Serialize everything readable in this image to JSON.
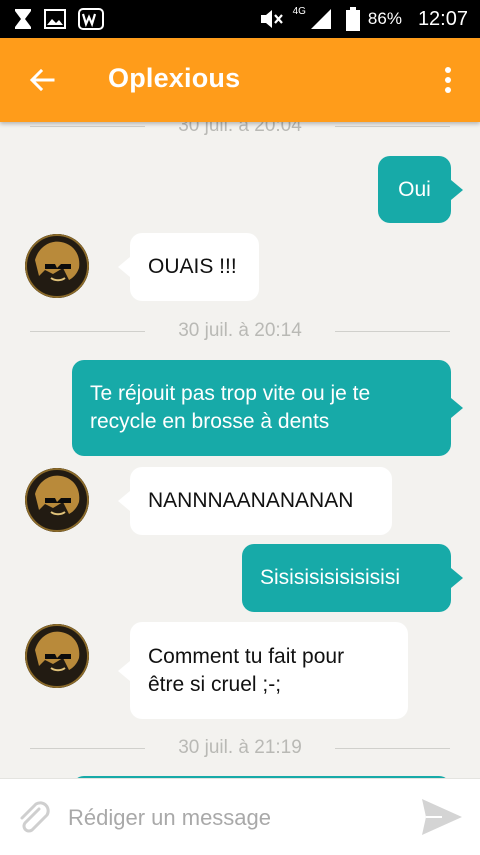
{
  "status_bar": {
    "network": "4G",
    "battery": "86%",
    "time": "12:07"
  },
  "header": {
    "title": "Oplexious",
    "back_icon": "arrow-back-icon",
    "menu_icon": "more-vert-icon"
  },
  "messages": [
    {
      "type": "divider",
      "text": "30 juil. à 20:04"
    },
    {
      "type": "out",
      "text": "Oui"
    },
    {
      "type": "in",
      "text": "OUAIS !!!"
    },
    {
      "type": "divider",
      "text": "30 juil. à 20:14"
    },
    {
      "type": "out",
      "lines": [
        "Te réjouit pas trop vite ou je te",
        "recycle en brosse à dents"
      ]
    },
    {
      "type": "in",
      "text": "NANNNAANANANAN"
    },
    {
      "type": "out",
      "text": "Sisisisisisisisisi"
    },
    {
      "type": "in",
      "lines": [
        "Comment tu fait pour",
        "être si cruel ;-;"
      ]
    },
    {
      "type": "divider",
      "text": "30 juil. à 21:19"
    }
  ],
  "compose": {
    "placeholder": "Rédiger un message",
    "attach_icon": "paperclip-icon",
    "send_icon": "send-icon"
  },
  "colors": {
    "app_bar": "#ff9c1a",
    "outgoing_bubble": "#17aaa8",
    "incoming_bubble": "#ffffff",
    "background": "#f3f2ef"
  }
}
